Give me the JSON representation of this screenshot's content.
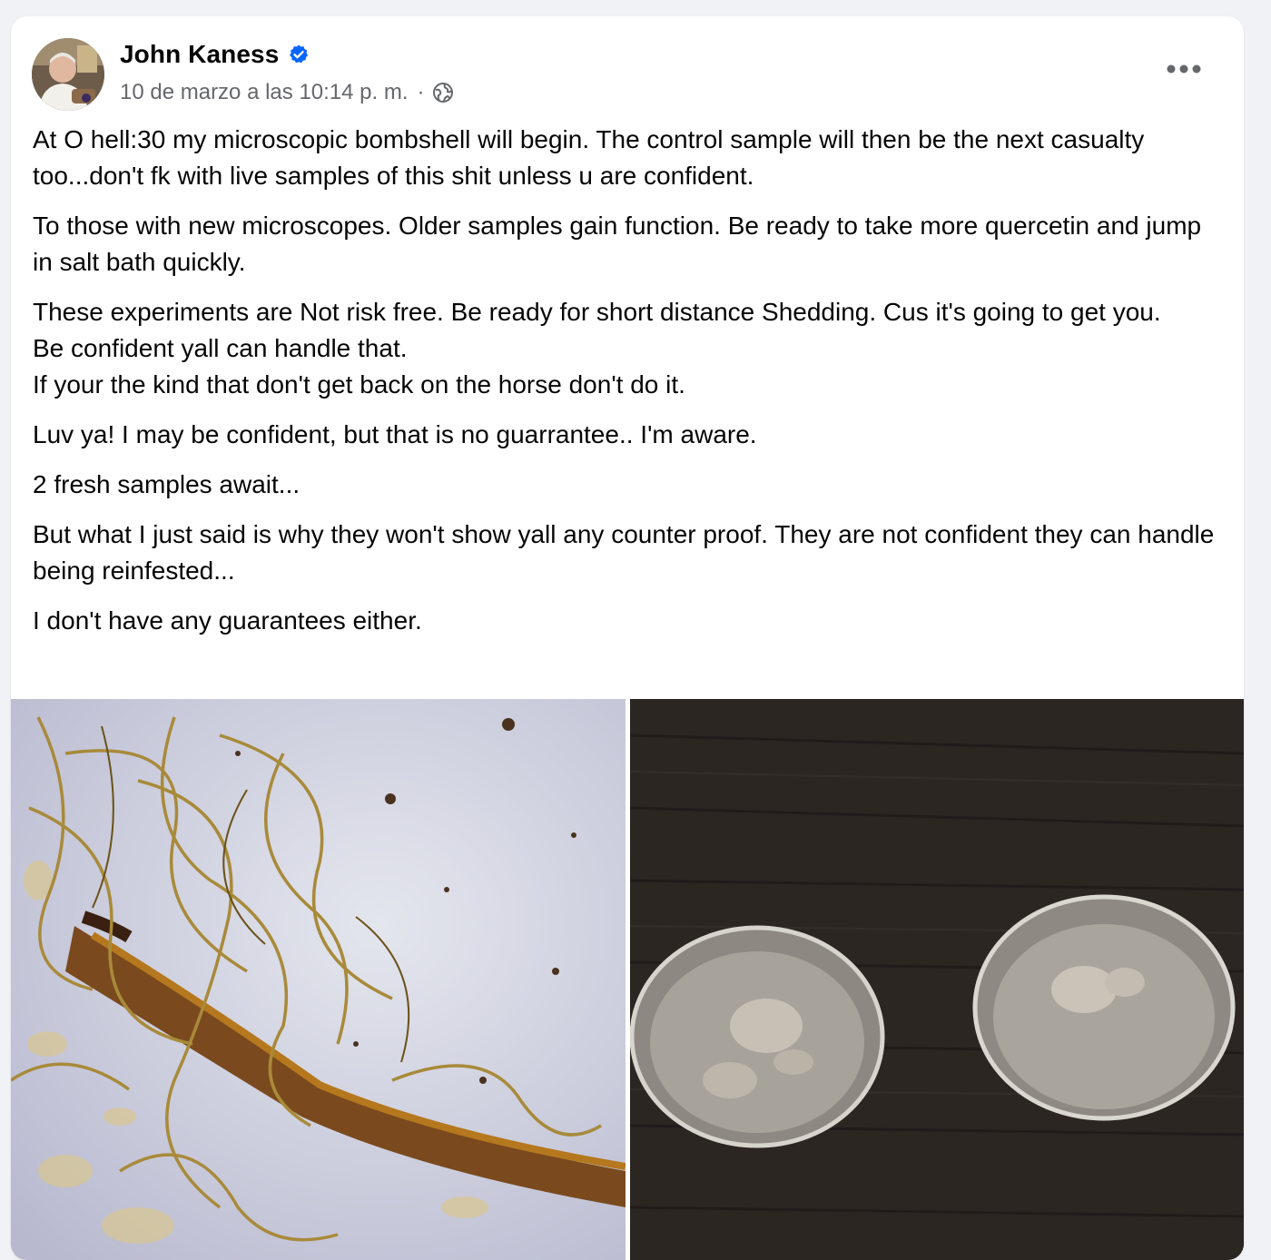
{
  "post": {
    "author_name": "John Kaness",
    "verified": true,
    "timestamp": "10 de marzo a las 10:14 p. m.",
    "separator": "·",
    "audience_icon": "globe-icon",
    "more_icon": "more-options-icon",
    "paragraphs": [
      "At O hell:30 my microscopic bombshell will begin. The control sample will then be the next casualty too...don't fk with live samples of this shit unless u are confident.",
      "To those with new microscopes. Older samples gain function. Be ready to take more quercetin and jump in salt bath quickly.",
      "These experiments are Not risk free. Be ready for short distance Shedding. Cus it's going to get you.\nBe confident yall can handle that.\nIf your the kind that don't get back on the horse don't do it.",
      "Luv ya! I may be confident, but that is no guarrantee.. I'm aware.",
      "2 fresh samples await...",
      "But what I just said is why they won't show yall any counter proof. They are not confident they can handle being reinfested...",
      "I don't have any guarantees either."
    ],
    "photos": [
      {
        "name": "microscope-fibers-photo"
      },
      {
        "name": "petri-dishes-photo"
      }
    ]
  },
  "colors": {
    "verified_blue": "#0866ff",
    "secondary_text": "#65676b",
    "primary_text": "#050505",
    "card_bg": "#ffffff",
    "page_bg": "#f0f2f5"
  }
}
